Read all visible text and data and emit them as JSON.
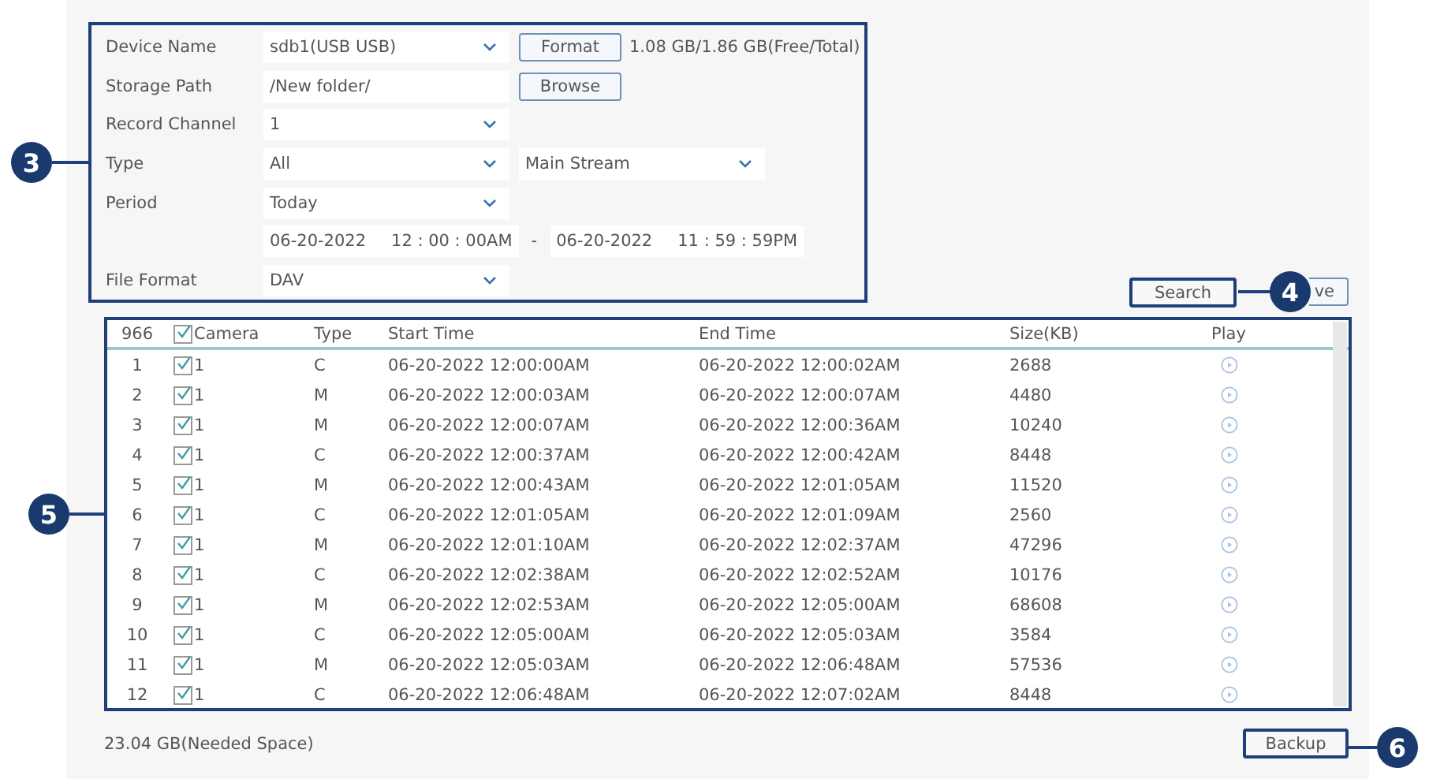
{
  "form": {
    "callout": "3",
    "rows": [
      {
        "kind": "select",
        "label": "Device Name",
        "value": "sdb1(USB USB)",
        "button": "Format",
        "info": "1.08 GB/1.86 GB(Free/Total)"
      },
      {
        "kind": "text",
        "label": "Storage Path",
        "value": "/New folder/",
        "button": "Browse"
      },
      {
        "kind": "select",
        "label": "Record Channel",
        "value": "1"
      },
      {
        "kind": "select",
        "label": "Type",
        "value": "All",
        "second_value": "Main Stream"
      },
      {
        "kind": "select",
        "label": "Period",
        "value": "Today"
      },
      {
        "kind": "range",
        "start_date": "06-20-2022",
        "start_time": "12 : 00 : 00AM",
        "separator": "-",
        "end_date": "06-20-2022",
        "end_time": "11 : 59 : 59PM"
      },
      {
        "kind": "select",
        "label": "File Format",
        "value": "DAV"
      }
    ]
  },
  "actions": {
    "search": "Search",
    "remove": "ve",
    "callout": "4"
  },
  "table": {
    "callout": "5",
    "count": "966",
    "camera_checked": true,
    "columns": [
      "Camera",
      "Type",
      "Start Time",
      "End Time",
      "Size(KB)",
      "Play"
    ],
    "rows": [
      {
        "index": "1",
        "checked": true,
        "camera": "1",
        "type": "C",
        "start": "06-20-2022 12:00:00AM",
        "end": "06-20-2022 12:00:02AM",
        "size": "2688"
      },
      {
        "index": "2",
        "checked": true,
        "camera": "1",
        "type": "M",
        "start": "06-20-2022 12:00:03AM",
        "end": "06-20-2022 12:00:07AM",
        "size": "4480"
      },
      {
        "index": "3",
        "checked": true,
        "camera": "1",
        "type": "M",
        "start": "06-20-2022 12:00:07AM",
        "end": "06-20-2022 12:00:36AM",
        "size": "10240"
      },
      {
        "index": "4",
        "checked": true,
        "camera": "1",
        "type": "C",
        "start": "06-20-2022 12:00:37AM",
        "end": "06-20-2022 12:00:42AM",
        "size": "8448"
      },
      {
        "index": "5",
        "checked": true,
        "camera": "1",
        "type": "M",
        "start": "06-20-2022 12:00:43AM",
        "end": "06-20-2022 12:01:05AM",
        "size": "11520"
      },
      {
        "index": "6",
        "checked": true,
        "camera": "1",
        "type": "C",
        "start": "06-20-2022 12:01:05AM",
        "end": "06-20-2022 12:01:09AM",
        "size": "2560"
      },
      {
        "index": "7",
        "checked": true,
        "camera": "1",
        "type": "M",
        "start": "06-20-2022 12:01:10AM",
        "end": "06-20-2022 12:02:37AM",
        "size": "47296"
      },
      {
        "index": "8",
        "checked": true,
        "camera": "1",
        "type": "C",
        "start": "06-20-2022 12:02:38AM",
        "end": "06-20-2022 12:02:52AM",
        "size": "10176"
      },
      {
        "index": "9",
        "checked": true,
        "camera": "1",
        "type": "M",
        "start": "06-20-2022 12:02:53AM",
        "end": "06-20-2022 12:05:00AM",
        "size": "68608"
      },
      {
        "index": "10",
        "checked": true,
        "camera": "1",
        "type": "C",
        "start": "06-20-2022 12:05:00AM",
        "end": "06-20-2022 12:05:03AM",
        "size": "3584"
      },
      {
        "index": "11",
        "checked": true,
        "camera": "1",
        "type": "M",
        "start": "06-20-2022 12:05:03AM",
        "end": "06-20-2022 12:06:48AM",
        "size": "57536"
      },
      {
        "index": "12",
        "checked": true,
        "camera": "1",
        "type": "C",
        "start": "06-20-2022 12:06:48AM",
        "end": "06-20-2022 12:07:02AM",
        "size": "8448"
      }
    ]
  },
  "footer": {
    "needed": "23.04 GB(Needed Space)",
    "backup": "Backup",
    "callout": "6"
  }
}
